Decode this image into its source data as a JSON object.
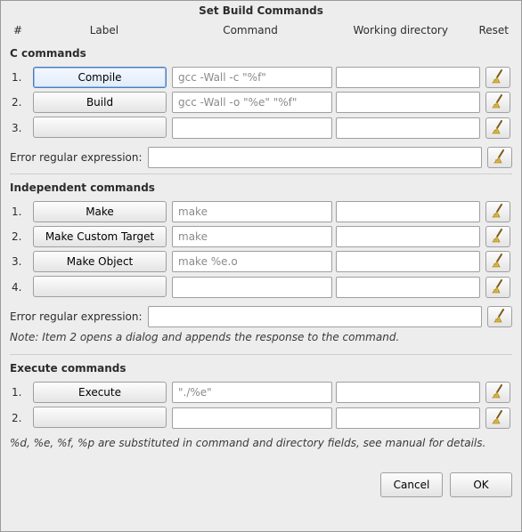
{
  "title": "Set Build Commands",
  "headers": {
    "num": "#",
    "label": "Label",
    "command": "Command",
    "dir": "Working directory",
    "reset": "Reset"
  },
  "sections": {
    "c": {
      "title": "C commands",
      "rows": [
        {
          "num": "1.",
          "label": "Compile",
          "cmd_placeholder": "gcc -Wall -c \"%f\"",
          "cmd_value": "",
          "dir_value": ""
        },
        {
          "num": "2.",
          "label": "Build",
          "cmd_placeholder": "gcc -Wall -o \"%e\" \"%f\"",
          "cmd_value": "",
          "dir_value": ""
        },
        {
          "num": "3.",
          "label": "",
          "cmd_placeholder": "",
          "cmd_value": "",
          "dir_value": ""
        }
      ],
      "error_label": "Error regular expression:",
      "error_value": ""
    },
    "indep": {
      "title": "Independent commands",
      "rows": [
        {
          "num": "1.",
          "label": "Make",
          "cmd_placeholder": "make",
          "cmd_value": "",
          "dir_value": ""
        },
        {
          "num": "2.",
          "label": "Make Custom Target",
          "cmd_placeholder": "make",
          "cmd_value": "",
          "dir_value": ""
        },
        {
          "num": "3.",
          "label": "Make Object",
          "cmd_placeholder": "make %e.o",
          "cmd_value": "",
          "dir_value": ""
        },
        {
          "num": "4.",
          "label": "",
          "cmd_placeholder": "",
          "cmd_value": "",
          "dir_value": ""
        }
      ],
      "error_label": "Error regular expression:",
      "error_value": "",
      "note": "Note: Item 2 opens a dialog and appends the response to the command."
    },
    "exec": {
      "title": "Execute commands",
      "rows": [
        {
          "num": "1.",
          "label": "Execute",
          "cmd_placeholder": "\"./%e\"",
          "cmd_value": "",
          "dir_value": ""
        },
        {
          "num": "2.",
          "label": "",
          "cmd_placeholder": "",
          "cmd_value": "",
          "dir_value": ""
        }
      ],
      "footnote": "%d, %e, %f, %p are substituted in command and directory fields, see manual for details."
    }
  },
  "buttons": {
    "cancel": "Cancel",
    "ok": "OK"
  },
  "icons": {
    "broom": "broom-icon"
  }
}
